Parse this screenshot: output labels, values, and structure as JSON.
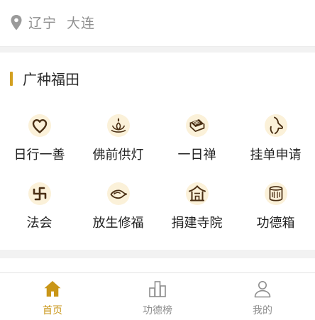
{
  "location": {
    "province": "辽宁",
    "city": "大连"
  },
  "section": {
    "title": "广种福田",
    "accent_color": "#d3a021",
    "items": [
      {
        "label": "日行一善",
        "icon": "heart-icon"
      },
      {
        "label": "佛前供灯",
        "icon": "lotus-lamp-icon"
      },
      {
        "label": "一日禅",
        "icon": "scripture-book-icon"
      },
      {
        "label": "挂单申请",
        "icon": "buddha-hand-icon"
      },
      {
        "label": "法会",
        "icon": "swastika-icon"
      },
      {
        "label": "放生修福",
        "icon": "fish-icon"
      },
      {
        "label": "捐建寺院",
        "icon": "temple-icon"
      },
      {
        "label": "功德箱",
        "icon": "merit-box-icon"
      }
    ]
  },
  "tabbar": {
    "active_color": "#c99618",
    "tabs": [
      {
        "label": "首页",
        "icon": "home-icon",
        "active": true
      },
      {
        "label": "功德榜",
        "icon": "ranking-icon",
        "active": false
      },
      {
        "label": "我的",
        "icon": "user-icon",
        "active": false
      }
    ]
  }
}
